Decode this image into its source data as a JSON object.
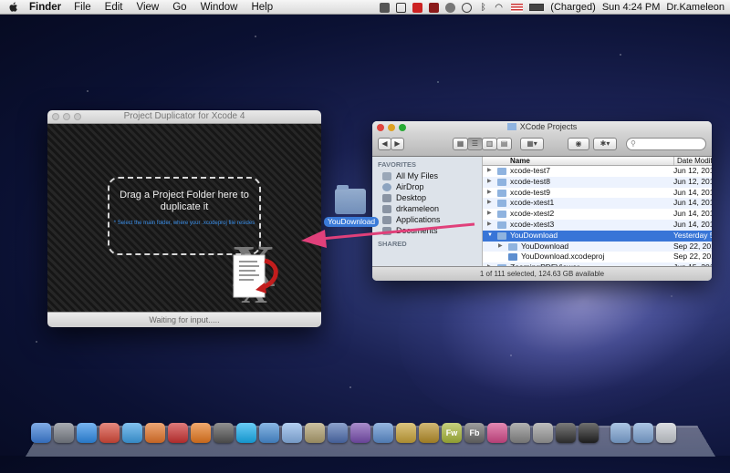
{
  "menubar": {
    "app_name": "Finder",
    "items": [
      "File",
      "Edit",
      "View",
      "Go",
      "Window",
      "Help"
    ],
    "battery_status": "(Charged)",
    "clock": "Sun 4:24 PM",
    "user": "Dr.Kameleon"
  },
  "project_duplicator": {
    "title": "Project Duplicator for Xcode 4",
    "drop_title": "Drag a Project Folder here to duplicate it",
    "drop_note": "* Select the main folder, where your .xcodeproj file resides",
    "status": "Waiting for input....."
  },
  "drag": {
    "label": "YouDownload"
  },
  "finder": {
    "title": "XCode Projects",
    "sidebar": {
      "favorites_header": "FAVORITES",
      "favorites": [
        {
          "label": "All My Files",
          "icon": "all-files-icon"
        },
        {
          "label": "AirDrop",
          "icon": "airdrop-icon"
        },
        {
          "label": "Desktop",
          "icon": "desktop-icon"
        },
        {
          "label": "drkameleon",
          "icon": "home-icon"
        },
        {
          "label": "Applications",
          "icon": "applications-icon"
        },
        {
          "label": "Documents",
          "icon": "documents-icon"
        }
      ],
      "shared_header": "SHARED"
    },
    "columns": {
      "name": "Name",
      "date": "Date Modifi"
    },
    "rows": [
      {
        "name": "xcode-test7",
        "date": "Jun 12, 201",
        "level": 0,
        "expanded": false,
        "selected": false
      },
      {
        "name": "xcode-test8",
        "date": "Jun 12, 201",
        "level": 0,
        "expanded": false,
        "selected": false
      },
      {
        "name": "xcode-test9",
        "date": "Jun 14, 201",
        "level": 0,
        "expanded": false,
        "selected": false
      },
      {
        "name": "xcode-xtest1",
        "date": "Jun 14, 201",
        "level": 0,
        "expanded": false,
        "selected": false
      },
      {
        "name": "xcode-xtest2",
        "date": "Jun 14, 201",
        "level": 0,
        "expanded": false,
        "selected": false
      },
      {
        "name": "xcode-xtest3",
        "date": "Jun 14, 201",
        "level": 0,
        "expanded": false,
        "selected": false
      },
      {
        "name": "YouDownload",
        "date": "Yesterday 5",
        "level": 0,
        "expanded": true,
        "selected": true
      },
      {
        "name": "YouDownload",
        "date": "Sep 22, 201",
        "level": 1,
        "expanded": false,
        "selected": false
      },
      {
        "name": "YouDownload.xcodeproj",
        "date": "Sep 22, 201",
        "level": 1,
        "expanded": false,
        "selected": false,
        "leaf": true
      },
      {
        "name": "ZoomingPDFViewer",
        "date": "Jun 15, 201",
        "level": 0,
        "expanded": false,
        "selected": false
      }
    ],
    "status": "1 of 111 selected, 124.63 GB available"
  },
  "dock": {
    "apps": [
      {
        "name": "finder",
        "color": "#3d7fd9"
      },
      {
        "name": "launchpad",
        "color": "#7a7f88"
      },
      {
        "name": "app-store",
        "color": "#2f8ce8"
      },
      {
        "name": "chrome",
        "color": "#d84a3a"
      },
      {
        "name": "safari",
        "color": "#3fa0e6"
      },
      {
        "name": "firefox",
        "color": "#e5762b"
      },
      {
        "name": "mail-app",
        "color": "#c33"
      },
      {
        "name": "xampp",
        "color": "#e97a20"
      },
      {
        "name": "terminal-x",
        "color": "#555"
      },
      {
        "name": "skype",
        "color": "#19aff0"
      },
      {
        "name": "network-app",
        "color": "#4a8fd6"
      },
      {
        "name": "cube-app",
        "color": "#8ab4e8"
      },
      {
        "name": "box-app",
        "color": "#b0a070"
      },
      {
        "name": "globe-app",
        "color": "#4f6fb0"
      },
      {
        "name": "purple-app",
        "color": "#7a4fb0"
      },
      {
        "name": "xcode",
        "color": "#5d8fd0"
      },
      {
        "name": "pencil-app",
        "color": "#c9a43a"
      },
      {
        "name": "flash-app",
        "color": "#b8902a"
      },
      {
        "name": "fireworks",
        "color": "#a8b83a"
      },
      {
        "name": "flash-builder",
        "color": "#6a6a6a"
      },
      {
        "name": "pink-app",
        "color": "#d44a8a"
      },
      {
        "name": "keyboard-app",
        "color": "#888"
      },
      {
        "name": "preferences",
        "color": "#9a9a9a"
      },
      {
        "name": "activity-monitor",
        "color": "#333"
      },
      {
        "name": "terminal",
        "color": "#222"
      },
      {
        "name": "folder-1",
        "color": "#7fa6d6"
      },
      {
        "name": "folder-2",
        "color": "#7fa6d6"
      },
      {
        "name": "trash",
        "color": "#c8ccd2"
      }
    ],
    "labels": {
      "fireworks": "Fw",
      "flash-builder": "Fb"
    }
  }
}
